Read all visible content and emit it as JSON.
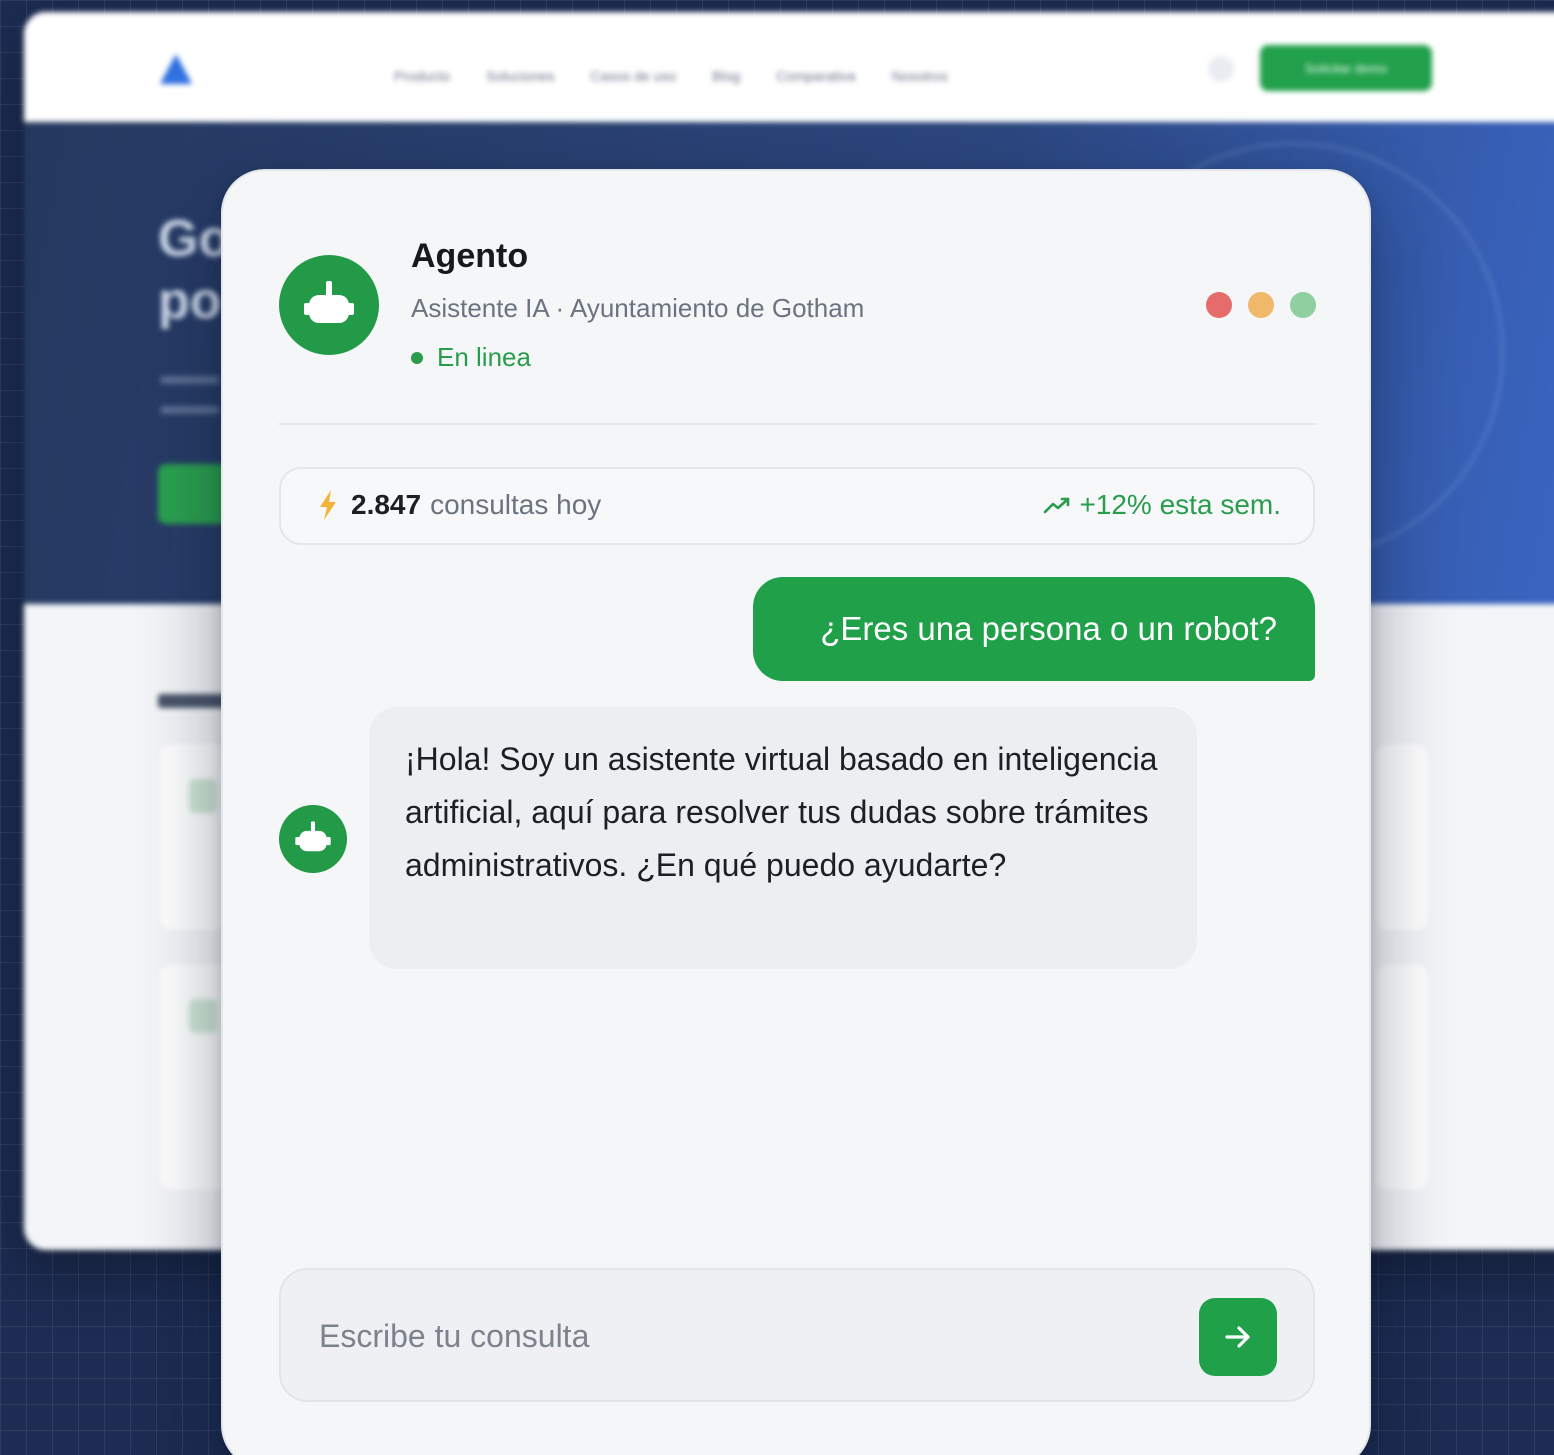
{
  "background_site": {
    "nav_links": [
      "Producto",
      "Soluciones",
      "Casos de uso",
      "Blog",
      "Comparativa",
      "Nosotros"
    ],
    "cta_label": "Solicitar demo",
    "hero_title_lines": [
      "Go",
      "po"
    ]
  },
  "chat": {
    "agent_name": "Agento",
    "agent_subtitle": "Asistente IA · Ayuntamiento de Gotham",
    "status": "En linea",
    "window_dots": [
      "#e66b6b",
      "#efb86b",
      "#8fd0a0"
    ],
    "stats": {
      "count": "2.847",
      "label": "consultas hoy",
      "trend": "+12% esta sem."
    },
    "messages": {
      "user": "¿Eres una persona o un robot?",
      "bot": "¡Hola! Soy un asistente virtual basado en inteligencia artificial, aquí para resolver tus dudas sobre trámites administrativos. ¿En qué puedo ayudarte?"
    },
    "input": {
      "placeholder": "Escribe tu consulta",
      "value": ""
    },
    "icons": {
      "avatar": "robot-icon",
      "stats_left": "lightning-icon",
      "stats_right": "trend-up-icon",
      "send": "arrow-right-icon"
    }
  },
  "colors": {
    "accent": "#21a04a",
    "status_green": "#2a9d4d",
    "page_bg": "#1c2c52"
  }
}
